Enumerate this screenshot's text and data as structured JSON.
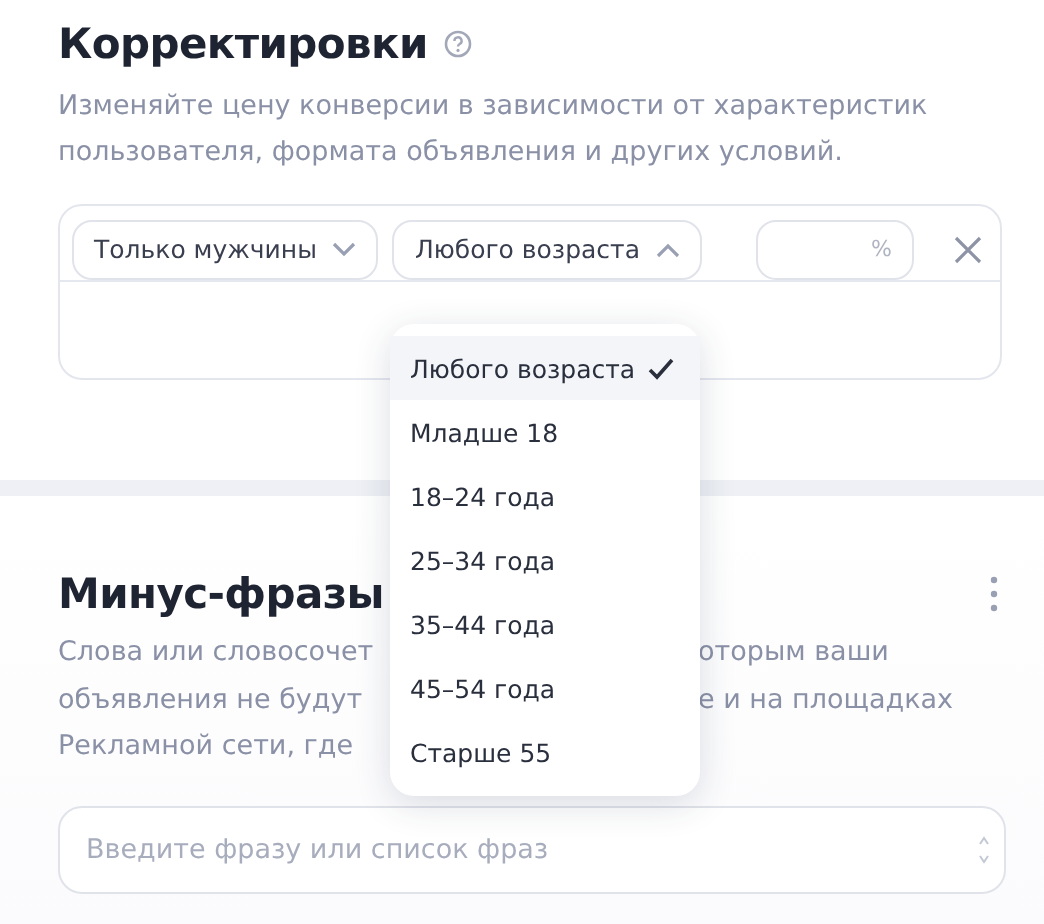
{
  "adjustments": {
    "title": "Корректировки",
    "description": "Изменяйте цену конверсии в зависимости от характеристик пользователя, формата объявления и других условий.",
    "rule": {
      "gender": {
        "value": "Только мужчины",
        "expanded": false
      },
      "age": {
        "value": "Любого возраста",
        "expanded": true
      },
      "percent": {
        "placeholder": "%"
      }
    },
    "age_options": [
      {
        "label": "Любого возраста",
        "selected": true
      },
      {
        "label": "Младше 18",
        "selected": false
      },
      {
        "label": "18–24 года",
        "selected": false
      },
      {
        "label": "25–34 года",
        "selected": false
      },
      {
        "label": "35–44 года",
        "selected": false
      },
      {
        "label": "45–54 года",
        "selected": false
      },
      {
        "label": "Старше 55",
        "selected": false
      }
    ]
  },
  "negative_phrases": {
    "title": "Минус-фразы",
    "description_lines": [
      {
        "left": "Слова или словосочет",
        "right": "оторым ваши"
      },
      {
        "left": "объявления не будут",
        "right": "е и на площадках"
      },
      {
        "left": "Рекламной сети, где"
      }
    ],
    "input": {
      "placeholder": "Введите фразу или список фраз"
    }
  }
}
